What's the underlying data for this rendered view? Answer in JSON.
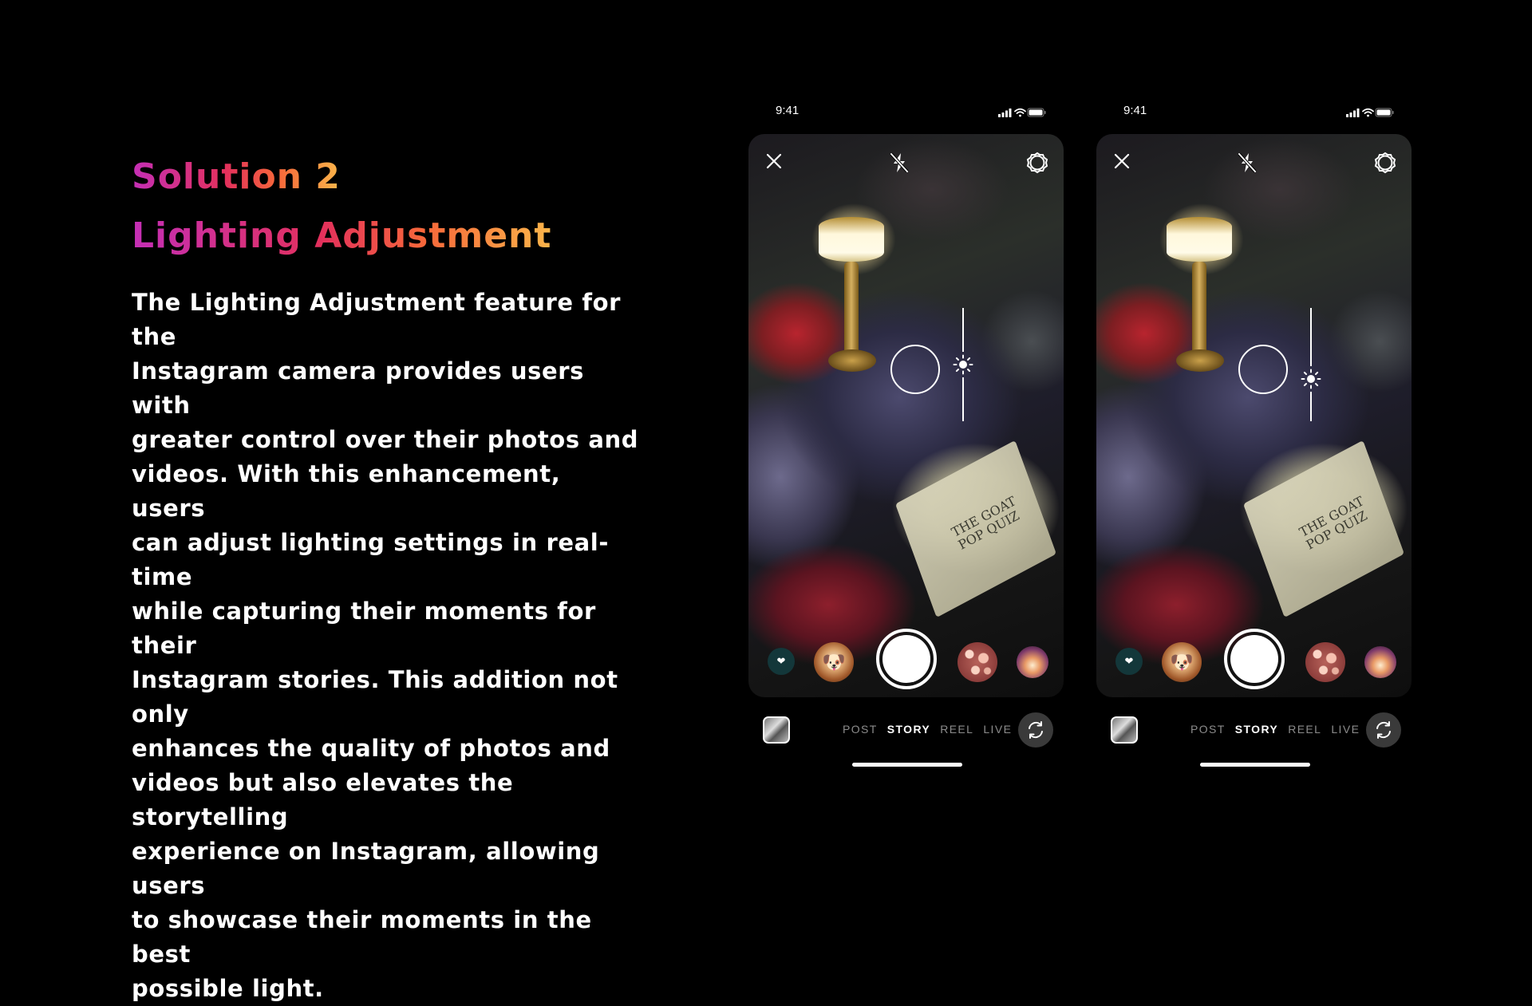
{
  "slide": {
    "title_line1": "Solution 2",
    "title_line2": "Lighting Adjustment",
    "description": "The Lighting Adjustment feature for the\nInstagram camera provides users with\ngreater control over their photos and\nvideos. With this enhancement, users\ncan adjust lighting settings in real-time\nwhile capturing their moments for their\nInstagram stories. This addition not only\nenhances the quality of photos and\nvideos but also elevates the storytelling\nexperience on Instagram, allowing users\nto showcase their moments in the best\npossible light."
  },
  "phones": [
    {
      "status_time": "9:41",
      "exposure_level": 0.5,
      "menu_card_text": "THE GOAT\nPOP QUIZ",
      "modes": [
        "POST",
        "STORY",
        "REEL",
        "LIVE"
      ],
      "active_mode": "STORY",
      "icons": [
        "close-icon",
        "flash-off-icon",
        "settings-icon",
        "sun-icon",
        "heart-icon",
        "gallery-icon",
        "camera-flip-icon"
      ]
    },
    {
      "status_time": "9:41",
      "exposure_level": 0.37,
      "menu_card_text": "THE GOAT\nPOP QUIZ",
      "modes": [
        "POST",
        "STORY",
        "REEL",
        "LIVE"
      ],
      "active_mode": "STORY",
      "icons": [
        "close-icon",
        "flash-off-icon",
        "settings-icon",
        "sun-icon",
        "heart-icon",
        "gallery-icon",
        "camera-flip-icon"
      ]
    }
  ],
  "colors": {
    "gradient_start": "#c42fb6",
    "gradient_mid": "#e3305c",
    "gradient_end": "#fbb54a",
    "background": "#000000",
    "mode_inactive": "#8c8c8c"
  }
}
